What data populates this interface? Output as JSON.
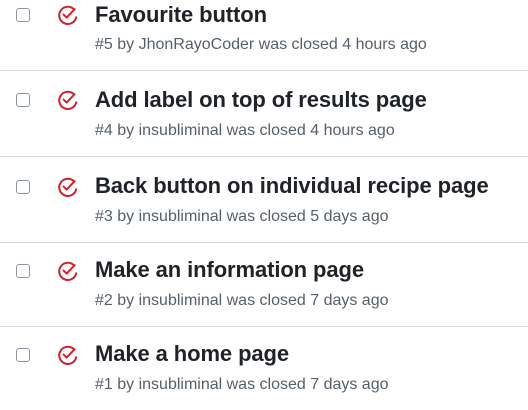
{
  "colors": {
    "closed_icon": "#cf222e",
    "title": "#1f2328",
    "meta": "#57606a",
    "divider": "#d0d7de"
  },
  "issues": [
    {
      "title": "Favourite button",
      "meta": "#5 by JhonRayoCoder was closed 4 hours ago",
      "icon": "issue-closed-icon"
    },
    {
      "title": "Add label on top of results page",
      "meta": "#4 by insubliminal was closed 4 hours ago",
      "icon": "issue-closed-icon"
    },
    {
      "title": "Back button on individual recipe page",
      "meta": "#3 by insubliminal was closed 5 days ago",
      "icon": "issue-closed-icon"
    },
    {
      "title": "Make an information page",
      "meta": "#2 by insubliminal was closed 7 days ago",
      "icon": "issue-closed-icon"
    },
    {
      "title": "Make a home page",
      "meta": "#1 by insubliminal was closed 7 days ago",
      "icon": "issue-closed-icon"
    }
  ]
}
